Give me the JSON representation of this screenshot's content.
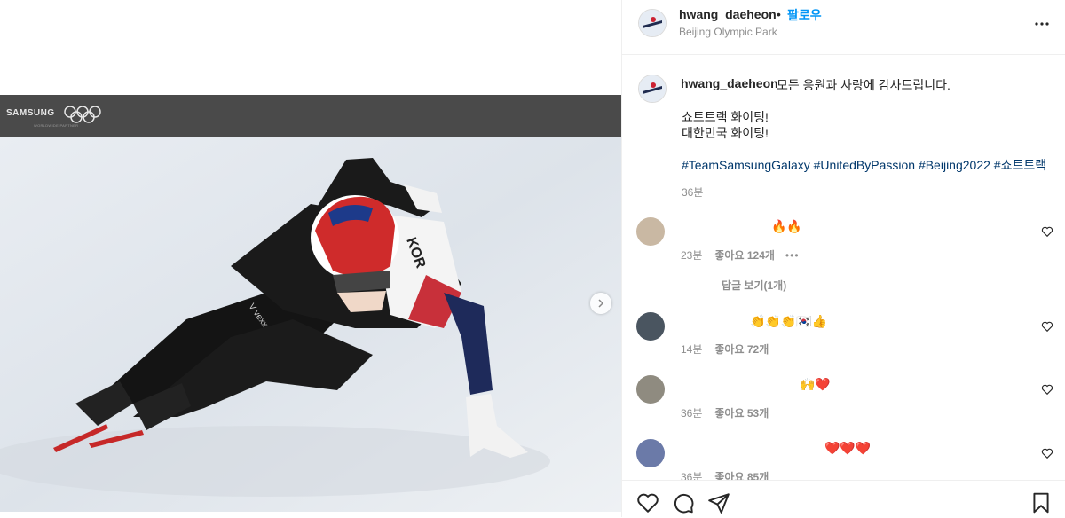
{
  "post": {
    "sponsor_text": "SAMSUNG",
    "sponsor_sub": "WORLDWIDE PARTNER",
    "helmet_text": "KOR",
    "suit_text": "V vexx"
  },
  "header": {
    "username": "hwang_daeheon",
    "separator": "•",
    "follow_label": "팔로우",
    "location": "Beijing Olympic Park"
  },
  "caption": {
    "username": "hwang_daeheon",
    "text": "모든 응원과 사랑에 감사드립니다.",
    "line2": "쇼트트랙 화이팅!",
    "line3": "대한민국 화이팅!",
    "hashtags": [
      "#TeamSamsungGalaxy",
      "#UnitedByPassion",
      "#Beijing2022",
      "#쇼트트랙"
    ],
    "time": "36분"
  },
  "comments": [
    {
      "emoji": "🔥🔥",
      "time": "23분",
      "likes": "좋아요 124개",
      "more": "•••",
      "avatar": "#c9b8a3"
    },
    {
      "emoji": "👏👏👏🇰🇷👍",
      "time": "14분",
      "likes": "좋아요 72개",
      "more": "",
      "avatar": "#4a5560"
    },
    {
      "emoji": "🙌❤️",
      "time": "36분",
      "likes": "좋아요 53개",
      "more": "",
      "avatar": "#8f8b80"
    },
    {
      "emoji": "❤️❤️❤️",
      "time": "36분",
      "likes": "좋아요 85개",
      "more": "",
      "avatar": "#6b7aa8"
    }
  ],
  "replies_label": "답글 보기(1개)",
  "icons": {
    "more": "more-icon",
    "like": "heart-icon",
    "comment": "comment-icon",
    "share": "share-icon",
    "save": "bookmark-icon",
    "next": "chevron-right-icon"
  },
  "colors": {
    "link": "#0095f6",
    "hashtag": "#00376b",
    "muted": "#8e8e8e"
  }
}
